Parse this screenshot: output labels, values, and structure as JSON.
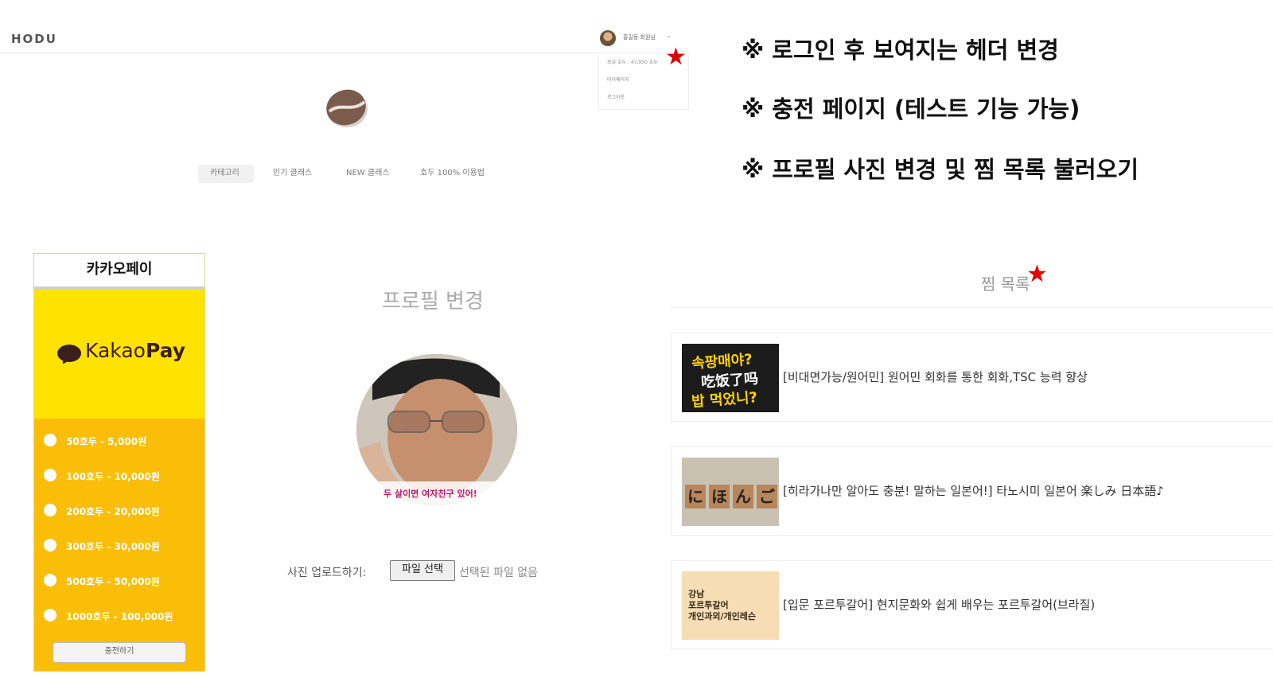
{
  "header": {
    "logo": "HODU",
    "user_name": "홍길동 회원님",
    "dropdown": [
      "보유 호두 : 47,950 호두",
      "마이페이지",
      "로그아웃"
    ]
  },
  "nav": {
    "tabs": [
      "카테고리",
      "인기 클래스",
      "NEW 클래스",
      "호두 100% 이용법"
    ]
  },
  "notes": [
    "※ 로그인 후 보여지는 헤더 변경",
    "※ 충전 페이지 (테스트 기능 가능)",
    "※ 프로필 사진 변경 및 찜 목록 불러오기"
  ],
  "kakaopay": {
    "title": "카카오페이",
    "brand_light": "Kakao",
    "brand_bold": "Pay",
    "options": [
      "50호두 - 5,000원",
      "100호두 - 10,000원",
      "200호두 - 20,000원",
      "300호두 - 30,000원",
      "500호두 - 50,000원",
      "1000호두 - 100,000원"
    ],
    "charge_button": "충전하기"
  },
  "profile": {
    "title": "프로필 변경",
    "photo_caption": "두 살이면 여자친구 있어!",
    "upload_label": "사진 업로드하기:",
    "file_button": "파일 선택",
    "file_status": "선택된 파일 없음"
  },
  "wishlist": {
    "title": "찜 목록",
    "items": [
      "[비대면가능/원어민] 원어민 회화를 통한 회화,TSC 능력 향상",
      "[히라가나만 알아도 충분! 말하는 일본어!] 타노시미 일본어 楽しみ 日本語♪",
      "[입문 포르투갈어] 현지문화와 쉽게 배우는 포르투갈어(브라질)"
    ],
    "thumb1_lines": [
      "속팡매야?",
      "吃饭了吗",
      "밥 먹었니?"
    ],
    "thumb2_tiles": [
      "に",
      "ほ",
      "ん",
      "ご"
    ],
    "thumb3_lines": [
      "강남",
      "포르투갈어",
      "개인과외/개인레슨"
    ]
  },
  "colors": {
    "kakao_yellow": "#ffe300",
    "kakao_orange": "#fbbe08",
    "star_red": "#e00000"
  }
}
